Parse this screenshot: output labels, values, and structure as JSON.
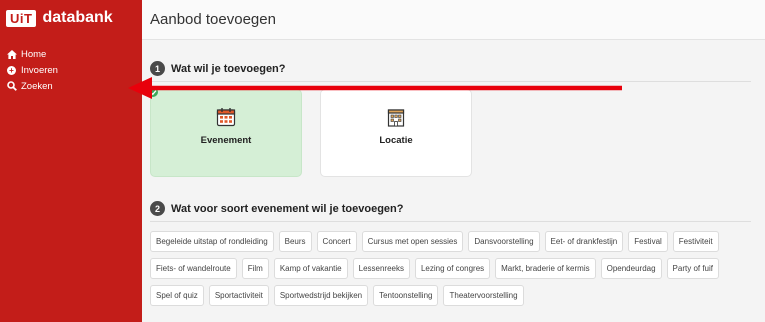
{
  "brand": {
    "logo": "UiT",
    "name": "databank"
  },
  "sidebar": {
    "items": [
      {
        "label": "Home"
      },
      {
        "label": "Invoeren"
      },
      {
        "label": "Zoeken"
      }
    ]
  },
  "header": {
    "title": "Aanbod toevoegen"
  },
  "steps": [
    {
      "number": "1",
      "title": "Wat wil je toevoegen?"
    },
    {
      "number": "2",
      "title": "Wat voor soort evenement wil je toevoegen?"
    }
  ],
  "options": [
    {
      "label": "Evenement",
      "icon": "calendar-icon",
      "selected": true
    },
    {
      "label": "Locatie",
      "icon": "building-icon",
      "selected": false
    }
  ],
  "event_types": [
    "Begeleide uitstap of rondleiding",
    "Beurs",
    "Concert",
    "Cursus met open sessies",
    "Dansvoorstelling",
    "Eet- of drankfestijn",
    "Festival",
    "Festiviteit",
    "Fiets- of wandelroute",
    "Film",
    "Kamp of vakantie",
    "Lessenreeks",
    "Lezing of congres",
    "Markt, braderie of kermis",
    "Opendeurdag",
    "Party of fuif",
    "Spel of quiz",
    "Sportactiviteit",
    "Sportwedstrijd bekijken",
    "Tentoonstelling",
    "Theatervoorstelling"
  ],
  "colors": {
    "sidebar": "#c31d19",
    "selected_card": "#d5efd6",
    "check": "#3ca85a",
    "annotation_arrow": "#e8000b"
  }
}
